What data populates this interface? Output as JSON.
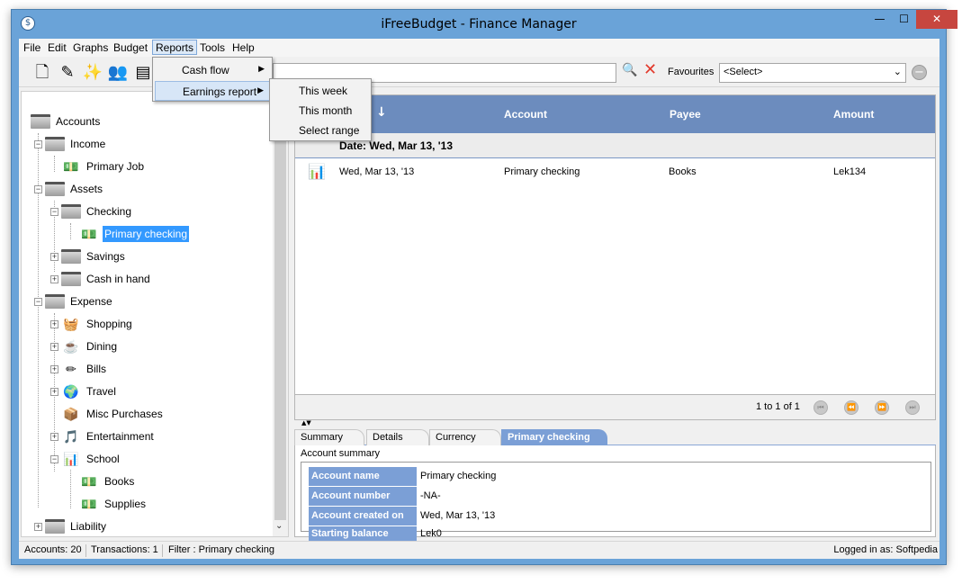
{
  "window": {
    "title": "iFreeBudget - Finance Manager"
  },
  "menu": [
    "File",
    "Edit",
    "Graphs",
    "Budget",
    "Reports",
    "Tools",
    "Help"
  ],
  "reports_menu": {
    "items": [
      "Cash flow",
      "Earnings report"
    ],
    "submenu": [
      "This week",
      "This month",
      "Select range"
    ]
  },
  "toolbar": {
    "favourites_label": "Favourites",
    "favourites_value": "<Select>",
    "search_value": ""
  },
  "tree": [
    {
      "label": "Accounts",
      "icon": "folder-icon"
    },
    {
      "label": "Income",
      "icon": "folder-icon"
    },
    {
      "label": "Primary Job",
      "icon": "money-icon"
    },
    {
      "label": "Assets",
      "icon": "folder-icon"
    },
    {
      "label": "Checking",
      "icon": "folder-icon"
    },
    {
      "label": "Primary checking",
      "icon": "money-icon"
    },
    {
      "label": "Savings",
      "icon": "folder-icon"
    },
    {
      "label": "Cash in hand",
      "icon": "folder-icon"
    },
    {
      "label": "Expense",
      "icon": "folder-icon"
    },
    {
      "label": "Shopping",
      "icon": "basket-icon"
    },
    {
      "label": "Dining",
      "icon": "coffee-icon"
    },
    {
      "label": "Bills",
      "icon": "pencil-icon"
    },
    {
      "label": "Travel",
      "icon": "globe-icon"
    },
    {
      "label": "Misc Purchases",
      "icon": "box-icon"
    },
    {
      "label": "Entertainment",
      "icon": "music-icon"
    },
    {
      "label": "School",
      "icon": "presentation-icon"
    },
    {
      "label": "Books",
      "icon": "money-icon"
    },
    {
      "label": "Supplies",
      "icon": "money-icon"
    },
    {
      "label": "Liability",
      "icon": "folder-icon"
    }
  ],
  "grid": {
    "columns": [
      "Account",
      "Payee",
      "Amount"
    ],
    "group": "Date: Wed, Mar 13, '13",
    "rows": [
      {
        "date": "Wed, Mar 13, '13",
        "account": "Primary checking",
        "payee": "Books",
        "amount": "Lek134"
      }
    ],
    "pager": "1 to 1 of 1"
  },
  "tabs": [
    "Summary",
    "Details",
    "Currency",
    "Primary checking"
  ],
  "summary": {
    "title": "Account summary",
    "rows": [
      {
        "key": "Account name",
        "value": "Primary checking"
      },
      {
        "key": "Account number",
        "value": "-NA-"
      },
      {
        "key": "Account created on",
        "value": "Wed, Mar 13, '13"
      },
      {
        "key": "Starting balance",
        "value": "Lek0"
      }
    ]
  },
  "status": {
    "accounts": "Accounts: 20",
    "transactions": "Transactions: 1",
    "filter": "Filter : Primary checking",
    "login": "Logged in as: Softpedia"
  }
}
